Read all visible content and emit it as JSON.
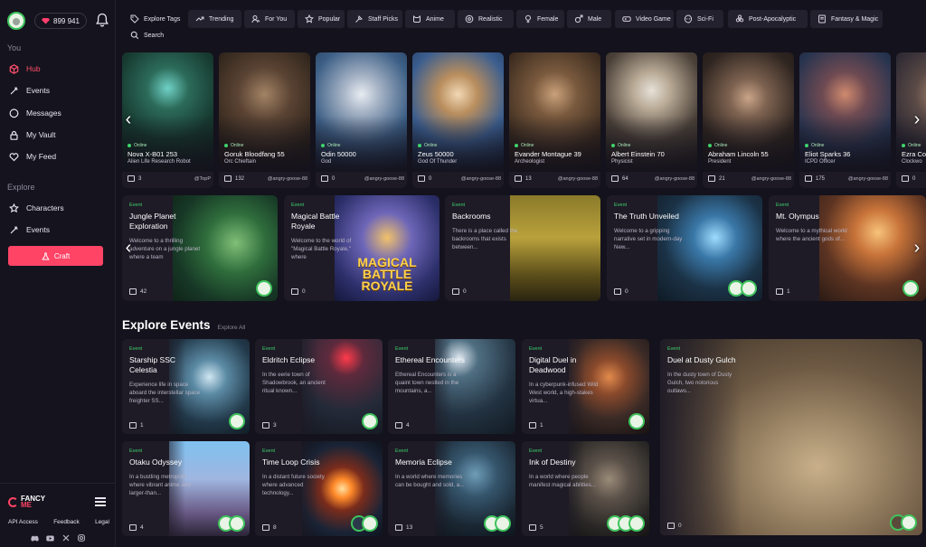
{
  "user": {
    "balance": "899 941"
  },
  "sidebar": {
    "section_you": "You",
    "nav_you": [
      {
        "label": "Hub",
        "icon": "cube-icon",
        "active": true
      },
      {
        "label": "Events",
        "icon": "sparkle-icon"
      },
      {
        "label": "Messages",
        "icon": "chat-icon"
      },
      {
        "label": "My Vault",
        "icon": "lock-icon"
      },
      {
        "label": "My Feed",
        "icon": "heart-icon"
      }
    ],
    "section_explore": "Explore",
    "nav_explore": [
      {
        "label": "Characters",
        "icon": "characters-icon"
      },
      {
        "label": "Events",
        "icon": "sparkle-icon"
      }
    ],
    "craft_label": "Craft",
    "logo_line1": "FANCY",
    "logo_line2": "ME",
    "footer_links": [
      "API Access",
      "Feedback",
      "Legal"
    ],
    "social": [
      "discord-icon",
      "youtube-icon",
      "x-icon",
      "instagram-icon"
    ]
  },
  "tags": {
    "explore_label": "Explore Tags",
    "search_label": "Search",
    "items": [
      "Trending",
      "For You",
      "Popular",
      "Staff Picks",
      "Anime",
      "Realistic",
      "Female",
      "Male",
      "Video Game",
      "Sci-Fi",
      "Post-Apocalyptic",
      "Fantasy & Magic"
    ]
  },
  "characters": [
    {
      "status": "Online",
      "name": "Nova X-B01 253",
      "role": "Alien Life Research Robot",
      "count": "3",
      "by": "@TopP"
    },
    {
      "status": "Online",
      "name": "Goruk Bloodfang 55",
      "role": "Orc Chieftain",
      "count": "132",
      "by": "@angry-goose-88"
    },
    {
      "status": "Online",
      "name": "Odin 50000",
      "role": "God",
      "count": "0",
      "by": "@angry-goose-88"
    },
    {
      "status": "Online",
      "name": "Zeus 50000",
      "role": "God Of Thunder",
      "count": "0",
      "by": "@angry-goose-88"
    },
    {
      "status": "Online",
      "name": "Evander Montague 39",
      "role": "Archeologist",
      "count": "13",
      "by": "@angry-goose-88"
    },
    {
      "status": "Online",
      "name": "Albert Einstein 70",
      "role": "Physicist",
      "count": "64",
      "by": "@angry-goose-88"
    },
    {
      "status": "Online",
      "name": "Abraham Lincoln 55",
      "role": "President",
      "count": "21",
      "by": "@angry-goose-88"
    },
    {
      "status": "Online",
      "name": "Eliot Sparks 36",
      "role": "ICPD Officer",
      "count": "175",
      "by": "@angry-goose-88"
    },
    {
      "status": "Online",
      "name": "Ezra Co",
      "role": "Clockwo",
      "count": "0",
      "by": ""
    }
  ],
  "featured_events": [
    {
      "label": "Event",
      "title": "Jungle Planet Exploration",
      "desc": "Welcome to a thrilling adventure on a jungle planet where a team",
      "count": "42"
    },
    {
      "label": "Event",
      "title": "Magical Battle Royale",
      "desc": "Welcome to the world of \"Magical Battle Royale,\" where",
      "count": "0",
      "art": "MAGICAL BATTLE ROYALE"
    },
    {
      "label": "Event",
      "title": "Backrooms",
      "desc": "There is a place called the backrooms that exists between...",
      "count": "0"
    },
    {
      "label": "Event",
      "title": "The Truth Unveiled",
      "desc": "Welcome to a gripping narrative set in modern-day New...",
      "count": "0"
    },
    {
      "label": "Event",
      "title": "Mt. Olympus",
      "desc": "Welcome to a mythical world where the ancient gods of...",
      "count": "1"
    }
  ],
  "explore": {
    "title": "Explore Events",
    "link": "Explore All",
    "events": [
      {
        "label": "Event",
        "title": "Starship SSC Celestia",
        "desc": "Experience life in space aboard the interstellar space freighter SS...",
        "count": "1"
      },
      {
        "label": "Event",
        "title": "Eldritch Eclipse",
        "desc": "In the eerie town of Shadowbrook, an ancient ritual known...",
        "count": "3"
      },
      {
        "label": "Event",
        "title": "Ethereal Encounters",
        "desc": "Ethereal Encounters is a quaint town nestled in the mountains, a...",
        "count": "4"
      },
      {
        "label": "Event",
        "title": "Digital Duel in Deadwood",
        "desc": "In a cyberpunk-infused Wild West world, a high-stakes virtua...",
        "count": "1"
      },
      {
        "label": "Event",
        "title": "Otaku Odyssey",
        "desc": "In a bustling metropolis where vibrant anime and larger-than...",
        "count": "4"
      },
      {
        "label": "Event",
        "title": "Time Loop Crisis",
        "desc": "In a distant future society where advanced technology...",
        "count": "8"
      },
      {
        "label": "Event",
        "title": "Memoria Eclipse",
        "desc": "In a world where memories can be bought and sold, a...",
        "count": "13"
      },
      {
        "label": "Event",
        "title": "Ink of Destiny",
        "desc": "In a world where people manifest magical abilities...",
        "count": "5"
      }
    ],
    "big_event": {
      "label": "Event",
      "title": "Duel at Dusty Gulch",
      "desc": "In the dusty town of Dusty Gulch, two notorious outlaws...",
      "count": "0"
    }
  }
}
